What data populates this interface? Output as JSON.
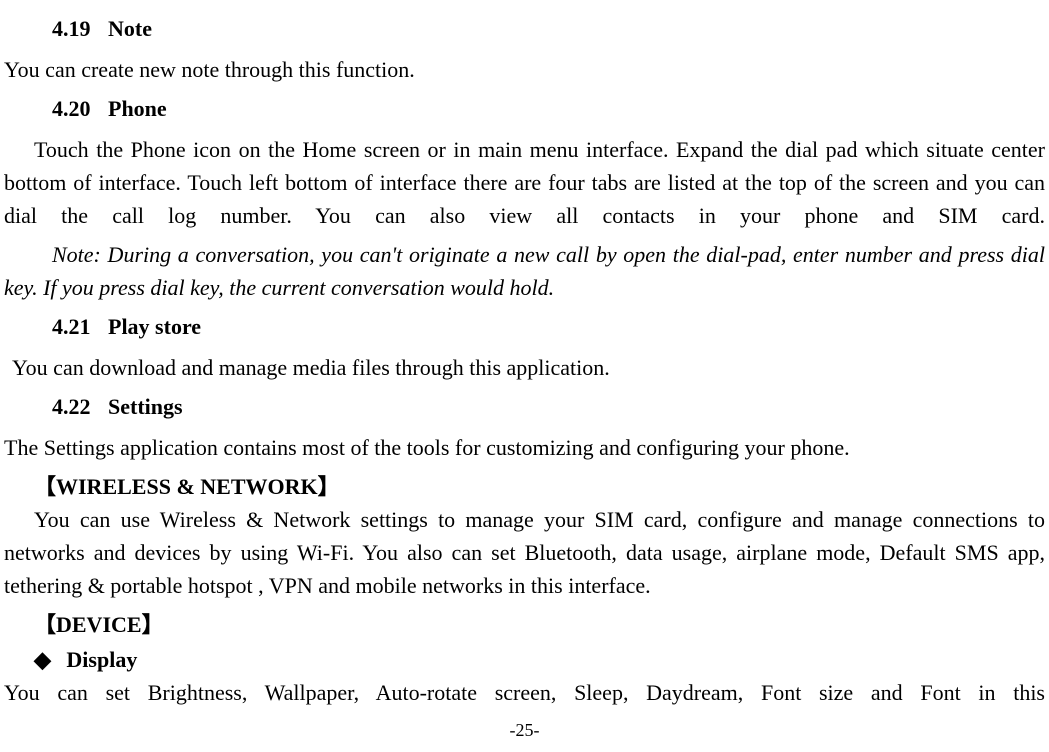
{
  "sections": {
    "s419": {
      "number": "4.19",
      "title": "Note",
      "body": "You can create new note through this function."
    },
    "s420": {
      "number": "4.20",
      "title": "Phone",
      "body": "Touch the Phone icon on the Home screen or in main menu interface. Expand the dial pad which situate center bottom of interface. Touch left bottom of interface there are four tabs are listed at the top of the screen and you can dial the call log number. You can also view all contacts in your phone and SIM card.",
      "note": "Note: During a conversation, you can't originate a new call by open the dial-pad, enter number and press dial key. If you press dial key, the current conversation would hold."
    },
    "s421": {
      "number": "4.21",
      "title": "Play store",
      "body": "You can download and manage media files through this application."
    },
    "s422": {
      "number": "4.22",
      "title": "Settings",
      "body": "The Settings application contains most of the tools for customizing and configuring your phone.",
      "wireless_heading": "【WIRELESS & NETWORK】",
      "wireless_body": "You can use Wireless & Network settings to manage your SIM card, configure and manage connections to networks and devices by using Wi-Fi. You also can set Bluetooth, data usage, airplane mode, Default SMS app, tethering & portable hotspot , VPN and mobile networks in this interface.",
      "device_heading": "【DEVICE】",
      "display_heading": "Display",
      "display_body": "You can set Brightness, Wallpaper, Auto-rotate screen, Sleep, Daydream, Font size and Font in this"
    }
  },
  "diamond_glyph": "◆",
  "page_number": "-25-"
}
